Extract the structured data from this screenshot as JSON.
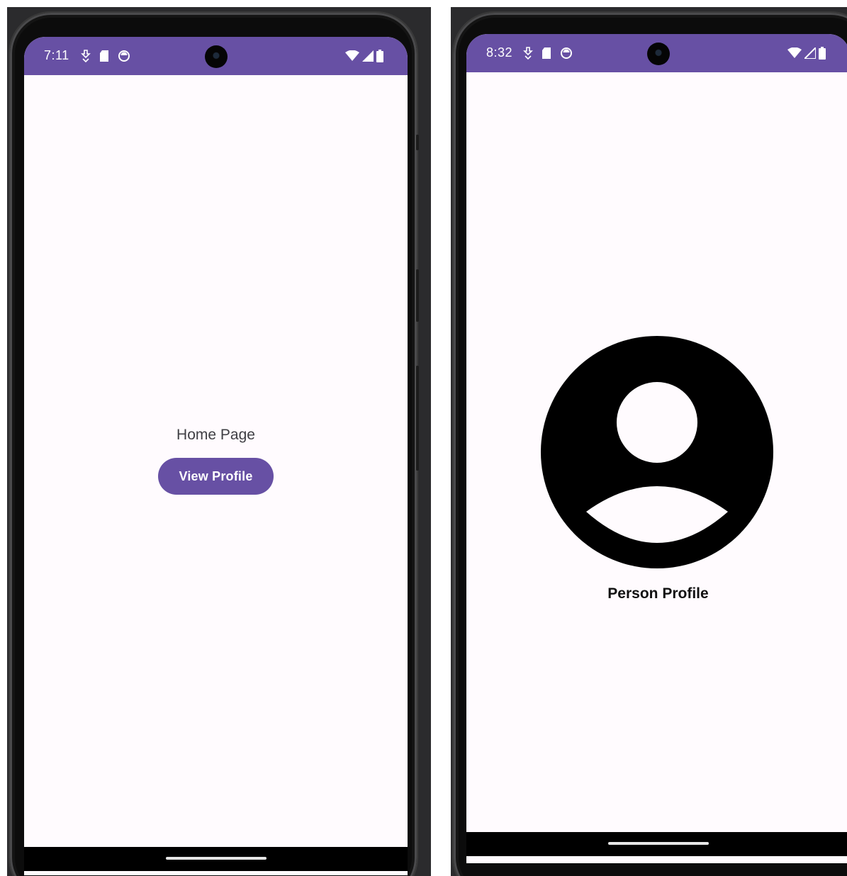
{
  "screens": [
    {
      "id": "home",
      "status_bar": {
        "time": "7:11",
        "left_icons": [
          "download-icon",
          "sd-card-icon",
          "app-notification-icon"
        ],
        "right_icons": [
          "wifi-icon",
          "signal-icon",
          "battery-icon"
        ]
      },
      "title": "Home Page",
      "button_label": "View Profile"
    },
    {
      "id": "profile",
      "status_bar": {
        "time": "8:32",
        "left_icons": [
          "download-icon",
          "sd-card-icon",
          "app-notification-icon"
        ],
        "right_icons": [
          "wifi-icon",
          "signal-icon",
          "battery-icon"
        ]
      },
      "avatar_icon": "account-circle-icon",
      "label": "Person Profile"
    }
  ],
  "colors": {
    "status_bar": "#6750a4",
    "primary_button": "#6750a4",
    "screen_background": "#fffbfe",
    "device_background": "#2b2b2d",
    "avatar": "#000000"
  }
}
